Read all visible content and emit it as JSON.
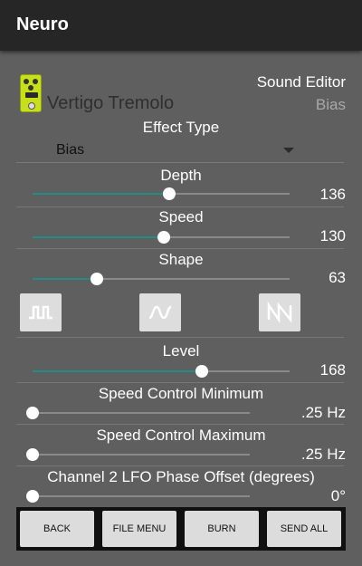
{
  "app": {
    "title": "Neuro"
  },
  "header": {
    "pedal_name": "Vertigo Tremolo",
    "editor_title": "Sound Editor",
    "editor_subtitle": "Bias",
    "pedal_color": "#c8e01a"
  },
  "effect_type": {
    "label": "Effect Type",
    "selected": "Bias"
  },
  "sliders": {
    "depth": {
      "label": "Depth",
      "value": "136",
      "fraction": 0.53
    },
    "speed": {
      "label": "Speed",
      "value": "130",
      "fraction": 0.51
    },
    "shape": {
      "label": "Shape",
      "value": "63",
      "fraction": 0.25
    },
    "level": {
      "label": "Level",
      "value": "168",
      "fraction": 0.66
    },
    "speed_min": {
      "label": "Speed Control Minimum",
      "value": ".25 Hz",
      "fraction": 0.0
    },
    "speed_max": {
      "label": "Speed Control Maximum",
      "value": ".25 Hz",
      "fraction": 0.0
    },
    "phase_offset": {
      "label": "Channel 2 LFO Phase Offset (degrees)",
      "value": "0°",
      "fraction": 0.0
    }
  },
  "shape_buttons": [
    {
      "icon": "square-wave-icon"
    },
    {
      "icon": "sine-wave-icon"
    },
    {
      "icon": "sawtooth-wave-icon"
    }
  ],
  "buttons": {
    "back": "BACK",
    "file_menu": "FILE MENU",
    "burn": "BURN",
    "send_all": "SEND ALL"
  },
  "colors": {
    "accent": "#1f8f86",
    "background": "#5f5f5f",
    "appbar": "#262626"
  }
}
